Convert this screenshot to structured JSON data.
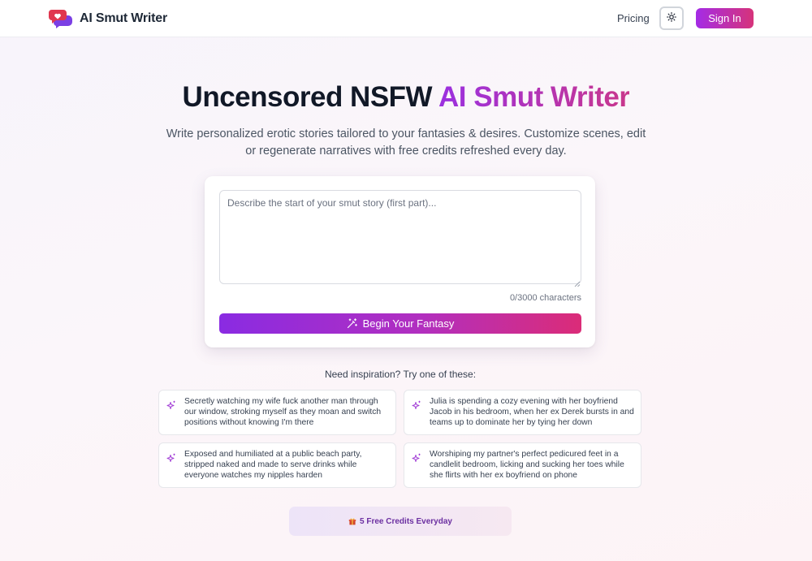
{
  "header": {
    "brand": "AI Smut Writer",
    "nav_pricing": "Pricing",
    "signin_label": "Sign In"
  },
  "hero": {
    "title_plain": "Uncensored NSFW ",
    "title_accent": "AI Smut Writer",
    "subtitle": "Write personalized erotic stories tailored to your fantasies & desires. Customize scenes, edit or regenerate narratives with free credits refreshed every day."
  },
  "composer": {
    "placeholder": "Describe the start of your smut story (first part)...",
    "value": "",
    "char_count": "0/3000 characters",
    "submit_label": "Begin Your Fantasy"
  },
  "inspiration": {
    "label": "Need inspiration? Try one of these:",
    "suggestions": [
      "Secretly watching my wife fuck another man through our window, stroking myself as they moan and switch positions without knowing I'm there",
      "Julia is spending a cozy evening with her boyfriend Jacob in his bedroom, when her ex Derek bursts in and teams up to dominate her by tying her down",
      "Exposed and humiliated at a public beach party, stripped naked and made to serve drinks while everyone watches my nipples harden",
      "Worshiping my partner's perfect pedicured feet in a candlelit bedroom, licking and sucking her toes while she flirts with her ex boyfriend on phone"
    ]
  },
  "credits_banner": "5 Free Credits Everyday",
  "icons": {
    "logo": "heart-chat-bubble-icon",
    "theme": "sun-icon",
    "submit": "magic-wand-icon",
    "suggestion": "sparkle-icon",
    "credits": "gift-icon"
  },
  "colors": {
    "brand_purple": "#a42be6",
    "brand_pink": "#d6337a",
    "logo_red": "#e0374f",
    "logo_violet": "#7b3fe4"
  }
}
